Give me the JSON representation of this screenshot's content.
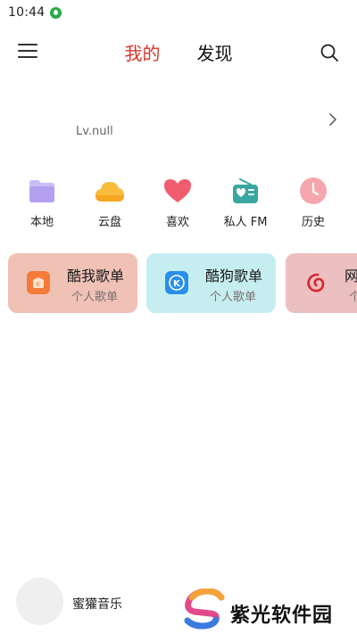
{
  "status_bar": {
    "time": "10:44"
  },
  "nav": {
    "tabs": [
      {
        "label": "我的",
        "active": true
      },
      {
        "label": "发现",
        "active": false
      }
    ]
  },
  "profile": {
    "level": "Lv.null"
  },
  "shortcuts": [
    {
      "label": "本地",
      "icon": "folder-icon",
      "color": "#b9a8f2"
    },
    {
      "label": "云盘",
      "icon": "cloud-icon",
      "color": "#f7b733"
    },
    {
      "label": "喜欢",
      "icon": "heart-icon",
      "color": "#f05a6e"
    },
    {
      "label": "私人 FM",
      "icon": "radio-icon",
      "color": "#3aa6a0"
    },
    {
      "label": "历史",
      "icon": "clock-icon",
      "color": "#f4a0a8"
    }
  ],
  "playlist_cards": [
    {
      "title": "酷我歌单",
      "subtitle": "个人歌单",
      "icon": "kuwo-logo-icon",
      "bg": "#f0c2b6"
    },
    {
      "title": "酷狗歌单",
      "subtitle": "个人歌单",
      "icon": "kugou-logo-icon",
      "bg": "#c6eef0"
    },
    {
      "title": "网",
      "subtitle": "个",
      "icon": "netease-logo-icon",
      "bg": "#ecc0c0"
    }
  ],
  "player": {
    "song": "蜜獾音乐"
  },
  "watermark": {
    "text": "紫光软件园"
  },
  "colors": {
    "accent": "#d9352a"
  }
}
